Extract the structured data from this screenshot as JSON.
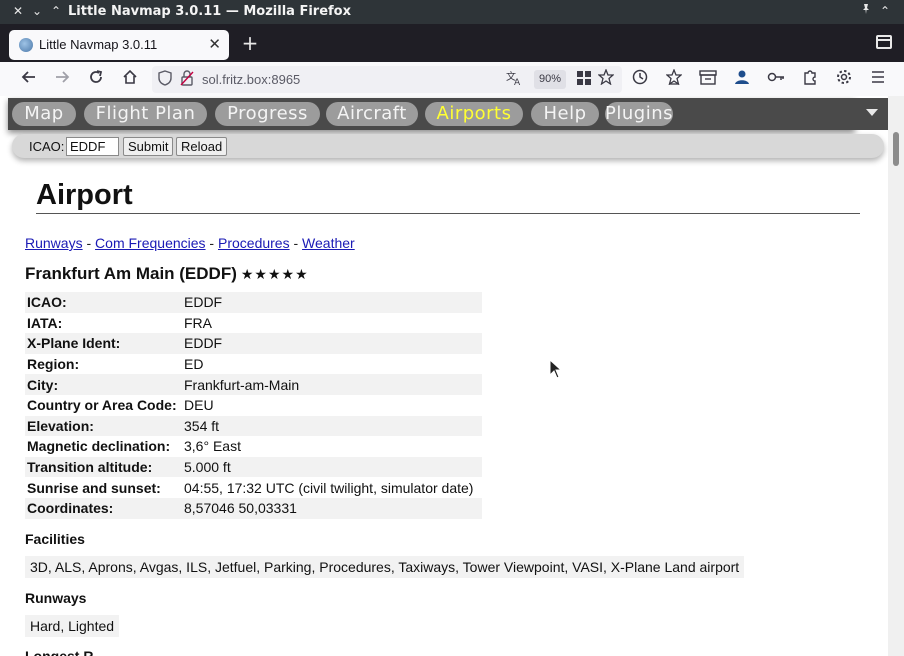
{
  "window": {
    "title": "Little Navmap 3.0.11 — Mozilla Firefox",
    "close_glyph": "✕",
    "minimize_glyph": "⌄",
    "maximize_glyph": "⌃",
    "pin_glyph": "📌",
    "keep_above_glyph": "⌃"
  },
  "tab": {
    "title": "Little Navmap 3.0.11",
    "close_glyph": "✕",
    "new_tab_glyph": "+"
  },
  "navbar": {
    "url": "sol.fritz.box:8965",
    "zoom": "90%",
    "icons": [
      "back-icon",
      "forward-icon",
      "reload-icon",
      "home-icon",
      "shield-icon",
      "lock-icon",
      "translate-icon",
      "extensions-grid-icon",
      "bookmark-star-icon",
      "history-icon",
      "library-icon",
      "container-icon",
      "account-icon",
      "passwords-key-icon",
      "puzzle-icon",
      "settings-gear-icon",
      "menu-icon"
    ]
  },
  "app_menu": {
    "items": [
      "Map",
      "Flight Plan",
      "Progress",
      "Aircraft",
      "Airports",
      "Help",
      "Plugins"
    ],
    "active": "Airports",
    "active_color": "#ffff33"
  },
  "icao_form": {
    "label": "ICAO:",
    "value": "EDDF",
    "submit_label": "Submit",
    "reload_label": "Reload"
  },
  "page": {
    "heading": "Airport",
    "links": [
      "Runways",
      "Com Frequencies",
      "Procedures",
      "Weather"
    ],
    "link_separator": " - ",
    "airport_name": "Frankfurt Am Main (EDDF)",
    "rating_stars": "★★★★★",
    "info": [
      {
        "key": "ICAO:",
        "value": "EDDF"
      },
      {
        "key": "IATA:",
        "value": "FRA"
      },
      {
        "key": "X-Plane Ident:",
        "value": "EDDF"
      },
      {
        "key": "Region:",
        "value": "ED"
      },
      {
        "key": "City:",
        "value": "Frankfurt-am-Main"
      },
      {
        "key": "Country or Area Code:",
        "value": "DEU"
      },
      {
        "key": "Elevation:",
        "value": "354 ft"
      },
      {
        "key": "Magnetic declination:",
        "value": "3,6° East"
      },
      {
        "key": "Transition altitude:",
        "value": "5.000 ft"
      },
      {
        "key": "Sunrise and sunset:",
        "value": "04:55, 17:32 UTC (civil twilight, simulator date)"
      },
      {
        "key": "Coordinates:",
        "value": "8,57046 50,03331"
      }
    ],
    "facilities_heading": "Facilities",
    "facilities": "3D, ALS, Aprons, Avgas, ILS, Jetfuel, Parking, Procedures, Taxiways, Tower Viewpoint, VASI, X-Plane Land airport",
    "runways_heading": "Runways",
    "runways": "Hard, Lighted",
    "next_heading": "Longest R..."
  }
}
